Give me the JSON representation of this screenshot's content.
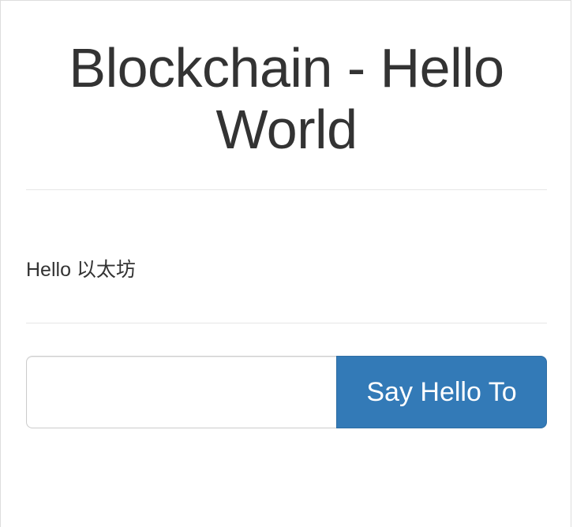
{
  "header": {
    "title": "Blockchain - Hello World"
  },
  "main": {
    "greeting": "Hello 以太坊",
    "form": {
      "name_input": {
        "value": "",
        "placeholder": ""
      },
      "submit_label": "Say Hello To"
    }
  },
  "colors": {
    "button_background": "#337ab7",
    "button_text": "#ffffff",
    "title_text": "#333333",
    "divider": "#e6e6e6"
  }
}
